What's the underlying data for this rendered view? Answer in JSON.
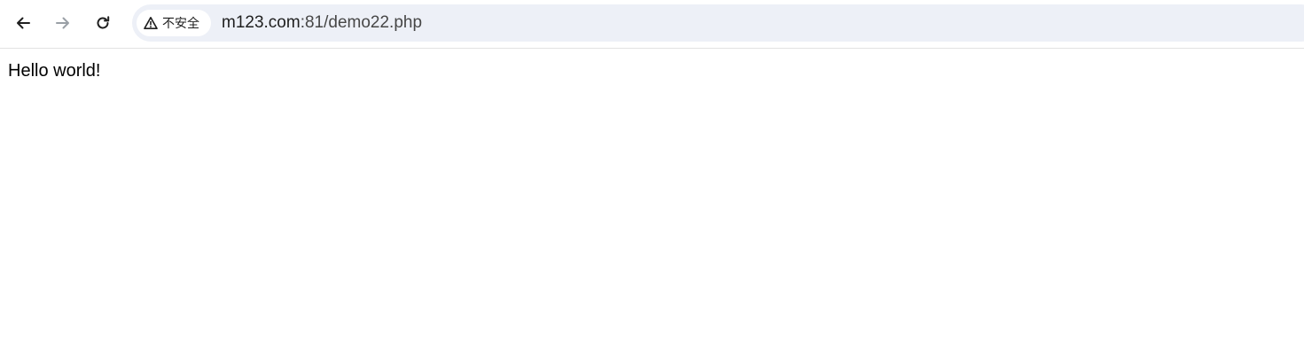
{
  "toolbar": {
    "back_icon": "arrow-left-icon",
    "forward_icon": "arrow-right-icon",
    "reload_icon": "reload-icon"
  },
  "omnibox": {
    "security_icon": "warning-triangle-icon",
    "security_label": "不安全",
    "url_host": "m123.com",
    "url_path": ":81/demo22.php"
  },
  "page": {
    "text": "Hello world!"
  },
  "colors": {
    "omnibox_bg": "#edf0f7",
    "text": "#1f1f1f",
    "forward_disabled": "#9aa0a6"
  }
}
